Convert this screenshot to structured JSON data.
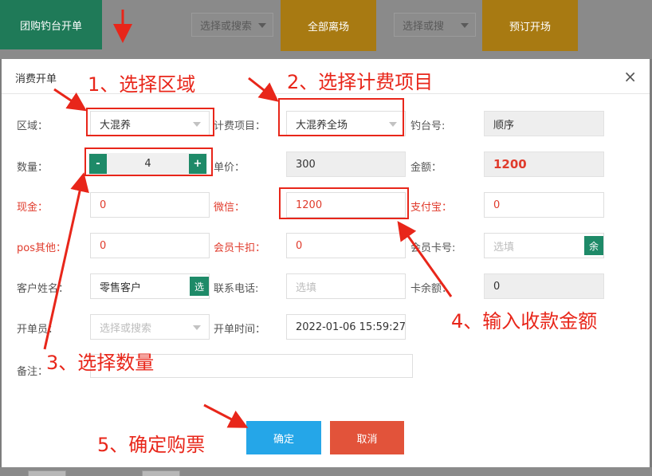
{
  "background": {
    "buttons": [
      "团购钓台开单",
      "全部离场",
      "预订开场"
    ],
    "selects": [
      "选择或搜索",
      "选择或搜"
    ]
  },
  "modal": {
    "title": "消费开单",
    "close": "×",
    "fields": {
      "area_label": "区域：",
      "area_value": "大混养",
      "billing_label": "计费项目：",
      "billing_value": "大混养全场",
      "seat_label": "钓台号:",
      "seat_value": "顺序",
      "qty_label": "数量：",
      "qty_value": "4",
      "qty_minus": "-",
      "qty_plus": "+",
      "price_label": "单价：",
      "price_value": "300",
      "amount_label": "金额：",
      "amount_value": "1200",
      "cash_label": "现金：",
      "cash_value": "0",
      "wechat_label": "微信：",
      "wechat_value": "1200",
      "alipay_label": "支付宝：",
      "alipay_value": "0",
      "pos_label": "pos其他：",
      "pos_value": "0",
      "card_deduct_label": "会员卡扣：",
      "card_deduct_value": "0",
      "card_no_label": "会员卡号:",
      "card_no_placeholder": "选填",
      "card_no_btn": "余",
      "customer_label": "客户姓名：",
      "customer_value": "零售客户",
      "customer_btn": "选",
      "phone_label": "联系电话:",
      "phone_placeholder": "选填",
      "balance_label": "卡余额：",
      "balance_value": "0",
      "operator_label": "开单员：",
      "operator_placeholder": "选择或搜索",
      "time_label": "开单时间：",
      "time_value": "2022-01-06 15:59:27",
      "remark_label": "备注："
    },
    "buttons": {
      "ok": "确定",
      "cancel": "取消"
    }
  },
  "annotations": {
    "step1": "1、选择区域",
    "step2": "2、选择计费项目",
    "step3": "3、选择数量",
    "step4": "4、输入收款金额",
    "step5": "5、确定购票"
  },
  "colors": {
    "accent_green": "#1e8a68",
    "annotation_red": "#e8261a",
    "ok_blue": "#25a6e8",
    "cancel_red": "#e2533a"
  }
}
